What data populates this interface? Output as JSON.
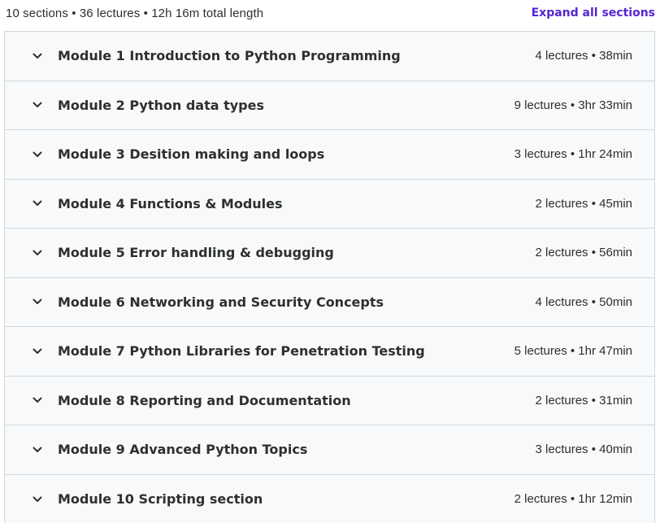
{
  "summary": {
    "text": "10 sections • 36 lectures • 12h 16m total length",
    "expand_label": "Expand all sections"
  },
  "icons": {
    "chevron": "chevron-down-icon"
  },
  "colors": {
    "accent": "#5624d0",
    "row_background": "#f7f9fa",
    "border": "#d1d7dc",
    "text": "#2d2f31"
  },
  "sections": [
    {
      "title": "Module 1 Introduction to Python Programming",
      "meta": "4 lectures • 38min"
    },
    {
      "title": "Module 2 Python data types",
      "meta": "9 lectures • 3hr 33min"
    },
    {
      "title": "Module 3 Desition making and loops",
      "meta": "3 lectures • 1hr 24min"
    },
    {
      "title": "Module 4 Functions & Modules",
      "meta": "2 lectures • 45min"
    },
    {
      "title": "Module 5 Error handling & debugging",
      "meta": "2 lectures • 56min"
    },
    {
      "title": "Module 6 Networking and Security Concepts",
      "meta": "4 lectures • 50min"
    },
    {
      "title": "Module 7 Python Libraries for Penetration Testing",
      "meta": "5 lectures • 1hr 47min"
    },
    {
      "title": "Module 8 Reporting and Documentation",
      "meta": "2 lectures • 31min"
    },
    {
      "title": "Module 9 Advanced Python Topics",
      "meta": "3 lectures • 40min"
    },
    {
      "title": "Module 10 Scripting section",
      "meta": "2 lectures • 1hr 12min"
    }
  ]
}
